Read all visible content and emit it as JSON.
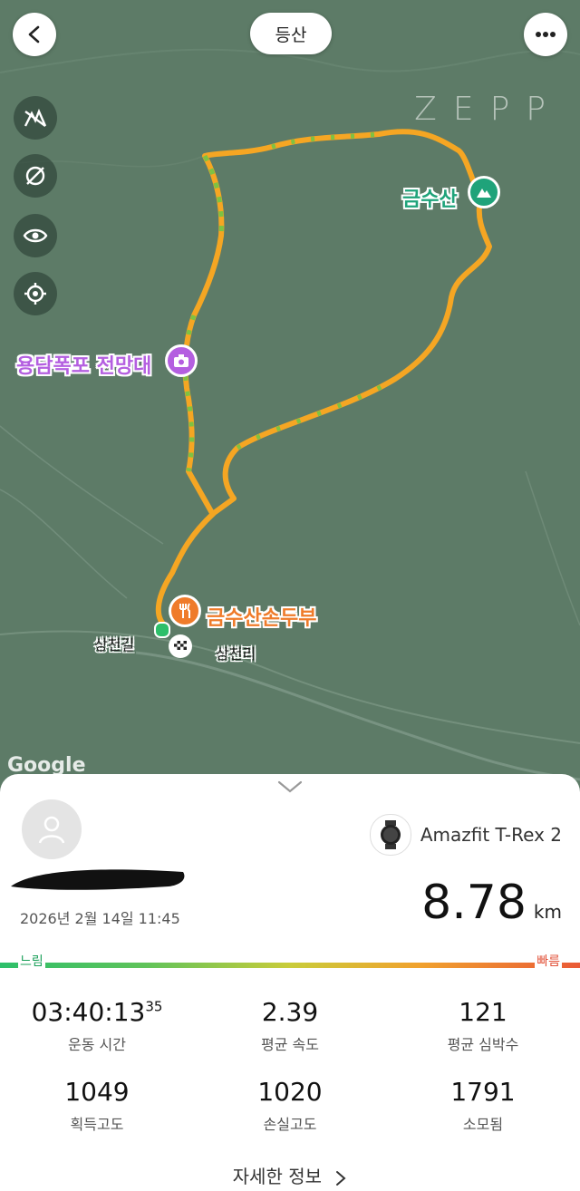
{
  "header": {
    "title": "등산",
    "logo": "ZEPP"
  },
  "map": {
    "poi": {
      "summit": "금수산",
      "viewpoint": "용담폭포 전망대",
      "restaurant": "금수산손두부"
    },
    "places": {
      "road": "상천길",
      "village": "상천리"
    },
    "attribution": "Google"
  },
  "tools": [
    "elevation-icon",
    "hide-icon",
    "eye-icon",
    "locate-icon"
  ],
  "summary": {
    "datetime": "2026년 2월 14일 11:45",
    "device": "Amazfit T-Rex 2",
    "distance": "8.78",
    "distance_unit": "km",
    "pace_slow": "느림",
    "pace_fast": "빠름"
  },
  "stats": [
    {
      "value": "03:40:13",
      "sup": "35",
      "label": "운동 시간"
    },
    {
      "value": "2.39",
      "sup": "",
      "label": "평균 속도"
    },
    {
      "value": "121",
      "sup": "",
      "label": "평균 심박수"
    },
    {
      "value": "1049",
      "sup": "",
      "label": "획득고도"
    },
    {
      "value": "1020",
      "sup": "",
      "label": "손실고도"
    },
    {
      "value": "1791",
      "sup": "",
      "label": "소모됨"
    }
  ],
  "detail_link": "자세한 정보",
  "colors": {
    "route": "#f5a623",
    "route_alt": "#7ec242",
    "summit": "#1fa37a",
    "viewpoint": "#b45fe0",
    "restaurant": "#ef7b2a"
  }
}
